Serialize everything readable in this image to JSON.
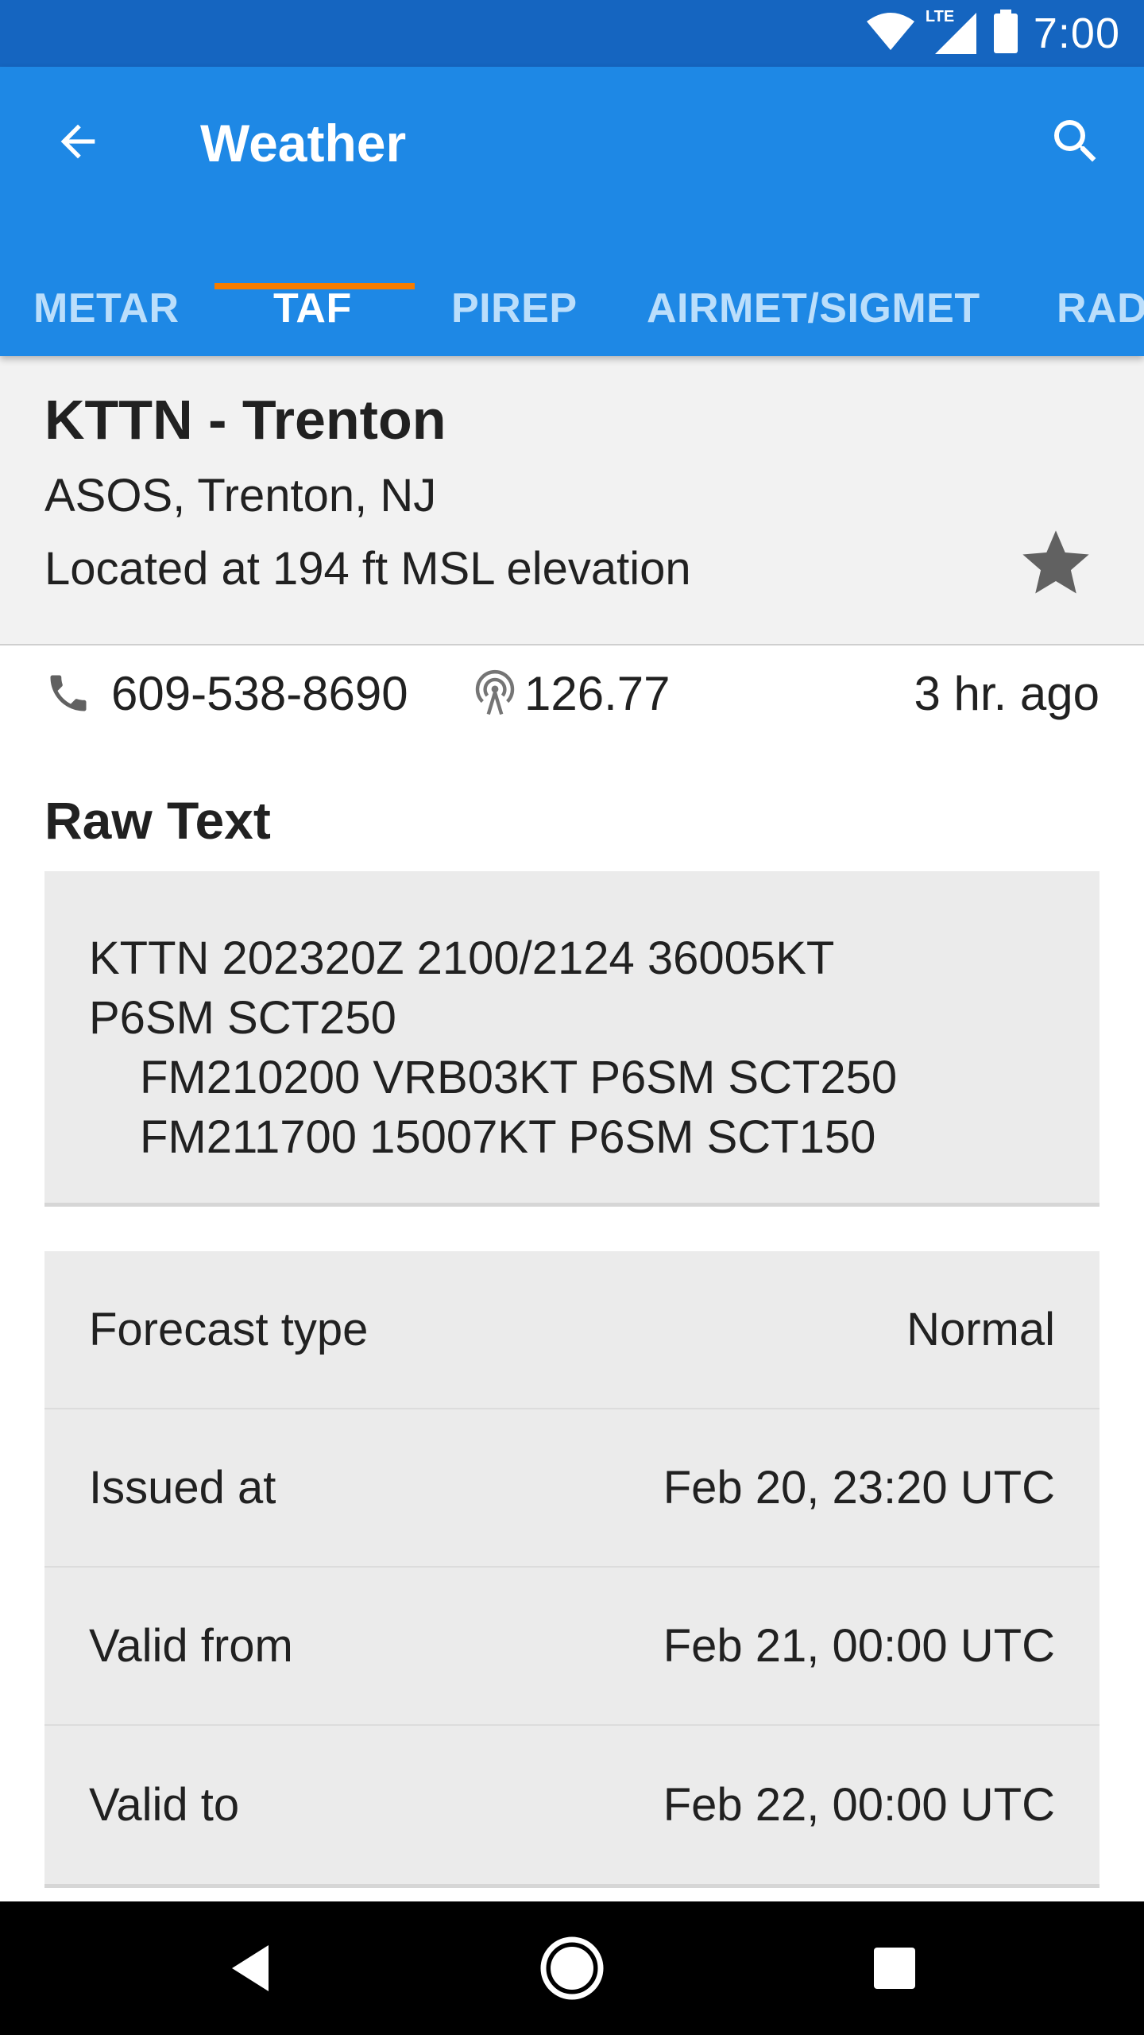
{
  "status_bar": {
    "time": "7:00",
    "network_label": "LTE",
    "icons": [
      "wifi-icon",
      "lte-signal-icon",
      "battery-icon"
    ]
  },
  "app_bar": {
    "title": "Weather",
    "back_icon": "arrow-back-icon",
    "search_icon": "search-icon",
    "colors": {
      "status": "#1565c0",
      "bar": "#1e88e5",
      "indicator": "#f57c00"
    }
  },
  "tabs": [
    {
      "label": "METAR",
      "active": false
    },
    {
      "label": "TAF",
      "active": true
    },
    {
      "label": "PIREP",
      "active": false
    },
    {
      "label": "AIRMET/SIGMET",
      "active": false
    },
    {
      "label": "RAD",
      "active": false
    }
  ],
  "station": {
    "name": "KTTN - Trenton",
    "type": "ASOS, Trenton, NJ",
    "elevation": "Located at 194 ft MSL elevation",
    "favorite_icon": "star-icon"
  },
  "info": {
    "phone": "609-538-8690",
    "frequency": "126.77",
    "age": "3 hr. ago",
    "phone_icon": "phone-icon",
    "frequency_icon": "radio-tower-icon"
  },
  "raw_text": {
    "heading": "Raw Text",
    "lines": [
      "KTTN 202320Z 2100/2124 36005KT",
      "P6SM SCT250",
      "FM210200 VRB03KT P6SM SCT250",
      "FM211700 15007KT P6SM SCT150"
    ]
  },
  "details": [
    {
      "label": "Forecast type",
      "value": "Normal"
    },
    {
      "label": "Issued at",
      "value": "Feb 20, 23:20 UTC"
    },
    {
      "label": "Valid from",
      "value": "Feb 21, 00:00 UTC"
    },
    {
      "label": "Valid to",
      "value": "Feb 22, 00:00 UTC"
    }
  ],
  "nav_bar": {
    "icons": [
      "nav-back-icon",
      "nav-home-icon",
      "nav-recents-icon"
    ]
  }
}
